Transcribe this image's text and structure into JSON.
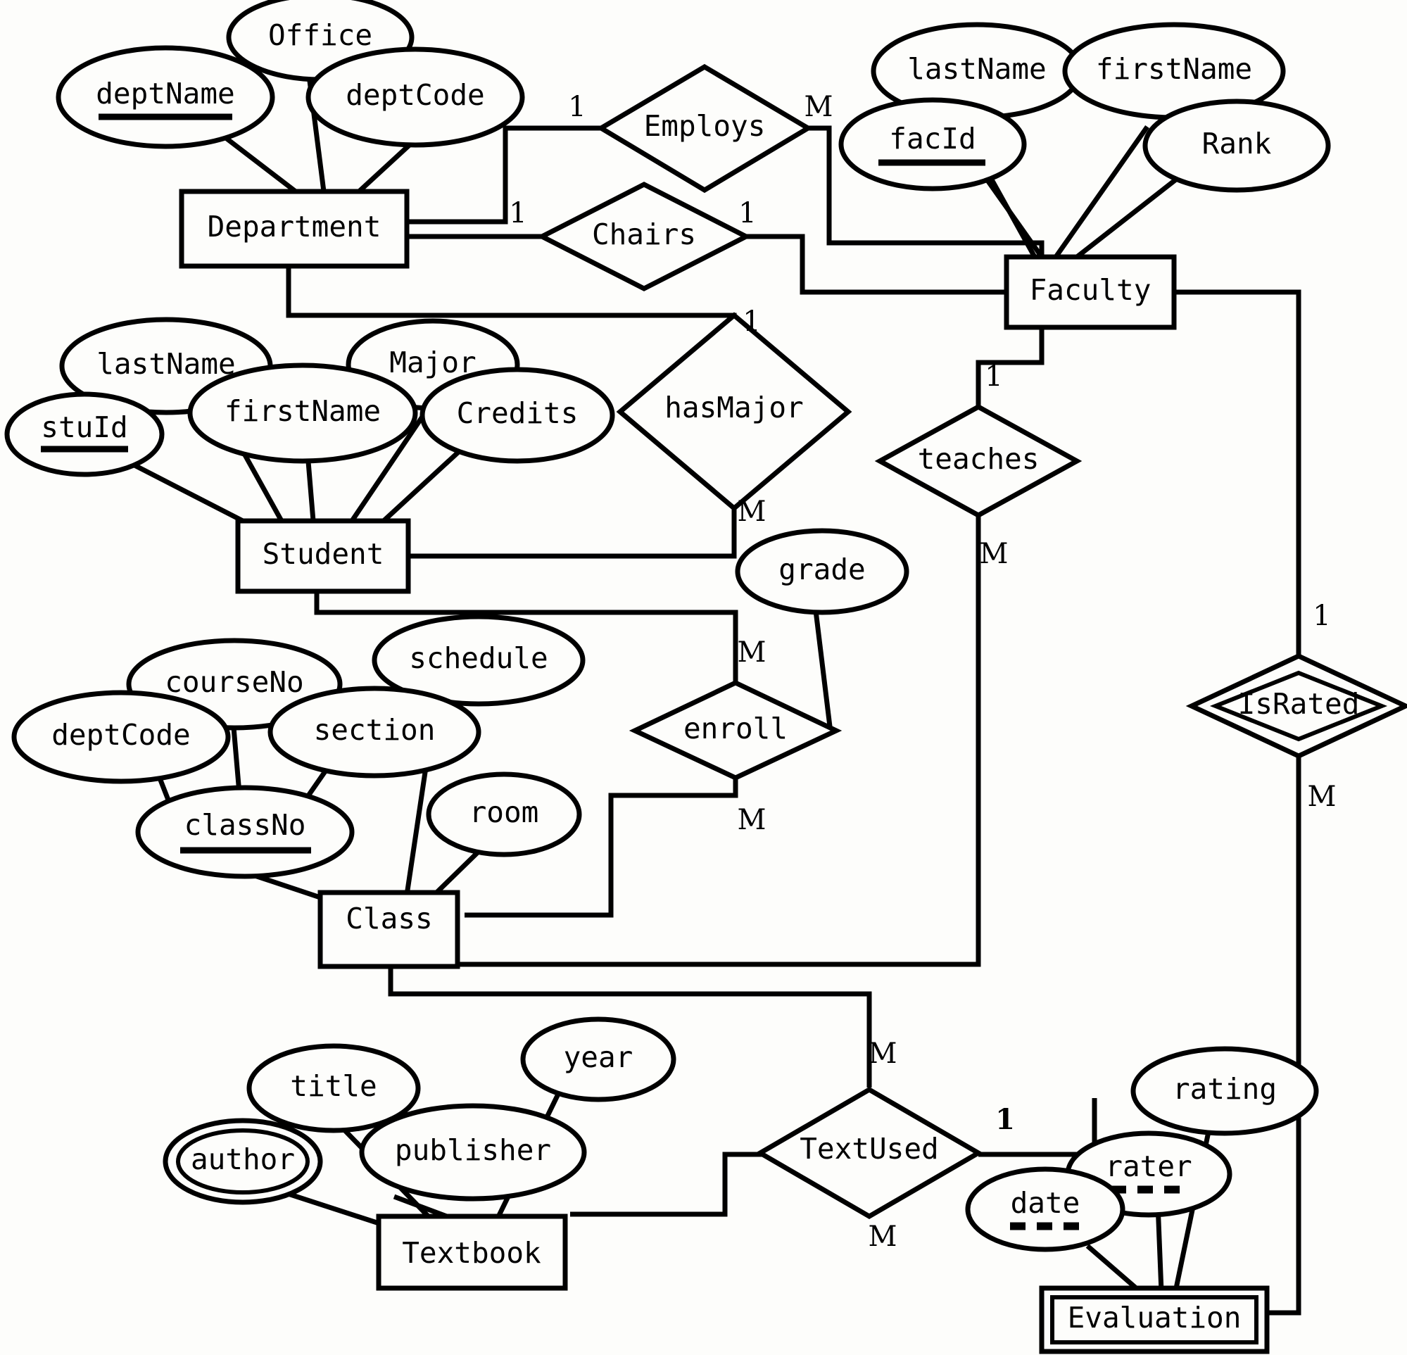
{
  "diagram": {
    "title": "University ER Diagram",
    "type": "entity-relationship-diagram",
    "notation": "Chen",
    "entities": [
      {
        "id": "department",
        "name": "Department",
        "kind": "strong",
        "attributes": [
          {
            "name": "deptName",
            "kind": "key"
          },
          {
            "name": "Office",
            "kind": "simple"
          },
          {
            "name": "deptCode",
            "kind": "simple"
          }
        ]
      },
      {
        "id": "faculty",
        "name": "Faculty",
        "kind": "strong",
        "attributes": [
          {
            "name": "lastName",
            "kind": "simple"
          },
          {
            "name": "firstName",
            "kind": "simple"
          },
          {
            "name": "facId",
            "kind": "key"
          },
          {
            "name": "Rank",
            "kind": "simple"
          }
        ]
      },
      {
        "id": "student",
        "name": "Student",
        "kind": "strong",
        "attributes": [
          {
            "name": "lastName",
            "kind": "simple"
          },
          {
            "name": "firstName",
            "kind": "simple"
          },
          {
            "name": "stuId",
            "kind": "key"
          },
          {
            "name": "Major",
            "kind": "simple"
          },
          {
            "name": "Credits",
            "kind": "simple"
          }
        ]
      },
      {
        "id": "class",
        "name": "Class",
        "kind": "strong",
        "attributes": [
          {
            "name": "courseNo",
            "kind": "simple"
          },
          {
            "name": "deptCode",
            "kind": "simple"
          },
          {
            "name": "section",
            "kind": "simple"
          },
          {
            "name": "schedule",
            "kind": "simple"
          },
          {
            "name": "room",
            "kind": "simple"
          },
          {
            "name": "classNo",
            "kind": "key"
          }
        ]
      },
      {
        "id": "textbook",
        "name": "Textbook",
        "kind": "strong",
        "attributes": [
          {
            "name": "title",
            "kind": "simple"
          },
          {
            "name": "author",
            "kind": "multivalued"
          },
          {
            "name": "publisher",
            "kind": "simple"
          },
          {
            "name": "year",
            "kind": "simple"
          }
        ]
      },
      {
        "id": "evaluation",
        "name": "Evaluation",
        "kind": "weak",
        "attributes": [
          {
            "name": "date",
            "kind": "partial-key"
          },
          {
            "name": "rater",
            "kind": "partial-key"
          },
          {
            "name": "rating",
            "kind": "simple"
          }
        ]
      }
    ],
    "relationships": [
      {
        "id": "employs",
        "name": "Employs",
        "kind": "normal",
        "left_card": "1",
        "right_card": "M"
      },
      {
        "id": "chairs",
        "name": "Chairs",
        "kind": "normal",
        "left_card": "1",
        "right_card": "1"
      },
      {
        "id": "hasmajor",
        "name": "hasMajor",
        "kind": "normal",
        "left_card": "1",
        "right_card": "M"
      },
      {
        "id": "teaches",
        "name": "teaches",
        "kind": "normal",
        "left_card": "1",
        "right_card": "M"
      },
      {
        "id": "enroll",
        "name": "enroll",
        "kind": "normal",
        "left_card": "M",
        "right_card": "M",
        "attributes": [
          {
            "name": "grade",
            "kind": "simple"
          }
        ]
      },
      {
        "id": "textused",
        "name": "TextUsed",
        "kind": "normal",
        "left_card": "M",
        "right_card": "1"
      },
      {
        "id": "israted",
        "name": "IsRated",
        "kind": "identifying",
        "left_card": "1",
        "right_card": "M"
      }
    ],
    "labels": {
      "deptName": "deptName",
      "office": "Office",
      "deptCode": "deptCode",
      "department": "Department",
      "employs": "Employs",
      "chairs": "Chairs",
      "lastNameFac": "lastName",
      "firstNameFac": "firstName",
      "facId": "facId",
      "rank": "Rank",
      "faculty": "Faculty",
      "lastNameStu": "lastName",
      "firstNameStu": "firstName",
      "stuId": "stuId",
      "major": "Major",
      "credits": "Credits",
      "hasMajor": "hasMajor",
      "student": "Student",
      "teaches": "teaches",
      "grade": "grade",
      "enroll": "enroll",
      "isRated": "IsRated",
      "courseNo": "courseNo",
      "deptCodeClass": "deptCode",
      "section": "section",
      "schedule": "schedule",
      "room": "room",
      "classNo": "classNo",
      "class": "Class",
      "title": "title",
      "author": "author",
      "publisher": "publisher",
      "year": "year",
      "textbook": "Textbook",
      "textUsed": "TextUsed",
      "rating": "rating",
      "rater": "rater",
      "date": "date",
      "evaluation": "Evaluation"
    },
    "cardinalities": {
      "employs_left": "1",
      "employs_right": "M",
      "chairs_left": "1",
      "chairs_right": "1",
      "hasMajor_top": "1",
      "hasMajor_bottom": "M",
      "teaches_top": "1",
      "teaches_bottom": "M",
      "enroll_top": "M",
      "enroll_bottom": "M",
      "textUsed_top": "M",
      "textUsed_bottom": "M",
      "textUsed_right": "1",
      "isRated_top": "1",
      "isRated_bottom": "M"
    },
    "colors": {
      "stroke": "#000000",
      "background": "#fdfdfb",
      "text": "#000000"
    }
  }
}
